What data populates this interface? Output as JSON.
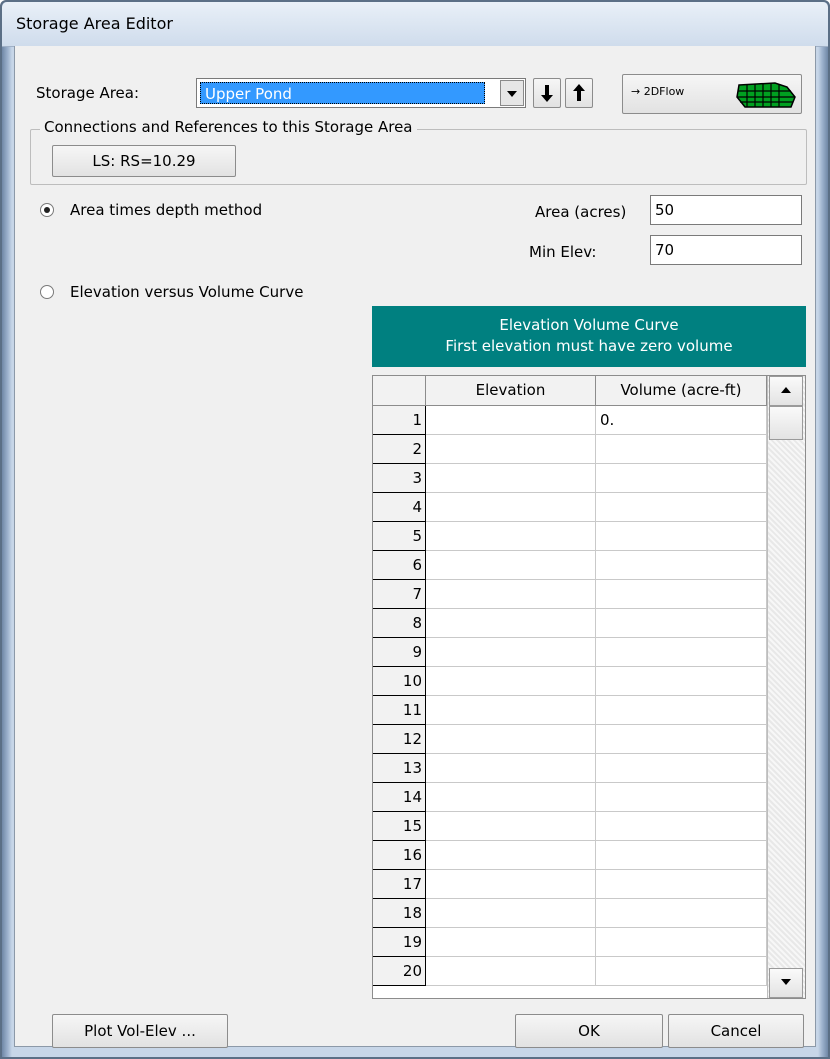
{
  "window": {
    "title": "Storage Area Editor"
  },
  "storage_area": {
    "label": "Storage Area:",
    "selected": "Upper Pond",
    "down_arrow_icon": "arrow-down-icon",
    "up_arrow_icon": "arrow-up-icon",
    "flow2d_label": "→ 2DFlow"
  },
  "connections": {
    "group_label": "Connections and References to this Storage Area",
    "item_label": "LS: RS=10.29"
  },
  "method_area_depth": {
    "label": "Area times depth method",
    "selected": true,
    "area_label": "Area (acres)",
    "area_value": "50",
    "min_elev_label": "Min Elev:",
    "min_elev_value": "70"
  },
  "method_curve": {
    "label": "Elevation versus Volume Curve",
    "selected": false
  },
  "curve_table": {
    "title_line1": "Elevation Volume Curve",
    "title_line2": "First elevation must have zero volume",
    "col_elevation": "Elevation",
    "col_volume": "Volume (acre-ft)",
    "rows": [
      {
        "n": "1",
        "elev": "",
        "vol": "0."
      },
      {
        "n": "2",
        "elev": "",
        "vol": ""
      },
      {
        "n": "3",
        "elev": "",
        "vol": ""
      },
      {
        "n": "4",
        "elev": "",
        "vol": ""
      },
      {
        "n": "5",
        "elev": "",
        "vol": ""
      },
      {
        "n": "6",
        "elev": "",
        "vol": ""
      },
      {
        "n": "7",
        "elev": "",
        "vol": ""
      },
      {
        "n": "8",
        "elev": "",
        "vol": ""
      },
      {
        "n": "9",
        "elev": "",
        "vol": ""
      },
      {
        "n": "10",
        "elev": "",
        "vol": ""
      },
      {
        "n": "11",
        "elev": "",
        "vol": ""
      },
      {
        "n": "12",
        "elev": "",
        "vol": ""
      },
      {
        "n": "13",
        "elev": "",
        "vol": ""
      },
      {
        "n": "14",
        "elev": "",
        "vol": ""
      },
      {
        "n": "15",
        "elev": "",
        "vol": ""
      },
      {
        "n": "16",
        "elev": "",
        "vol": ""
      },
      {
        "n": "17",
        "elev": "",
        "vol": ""
      },
      {
        "n": "18",
        "elev": "",
        "vol": ""
      },
      {
        "n": "19",
        "elev": "",
        "vol": ""
      },
      {
        "n": "20",
        "elev": "",
        "vol": ""
      }
    ]
  },
  "buttons": {
    "plot_label": "Plot Vol-Elev ...",
    "ok_label": "OK",
    "cancel_label": "Cancel"
  },
  "colors": {
    "teal_header": "#008080",
    "selection": "#3399ff"
  }
}
